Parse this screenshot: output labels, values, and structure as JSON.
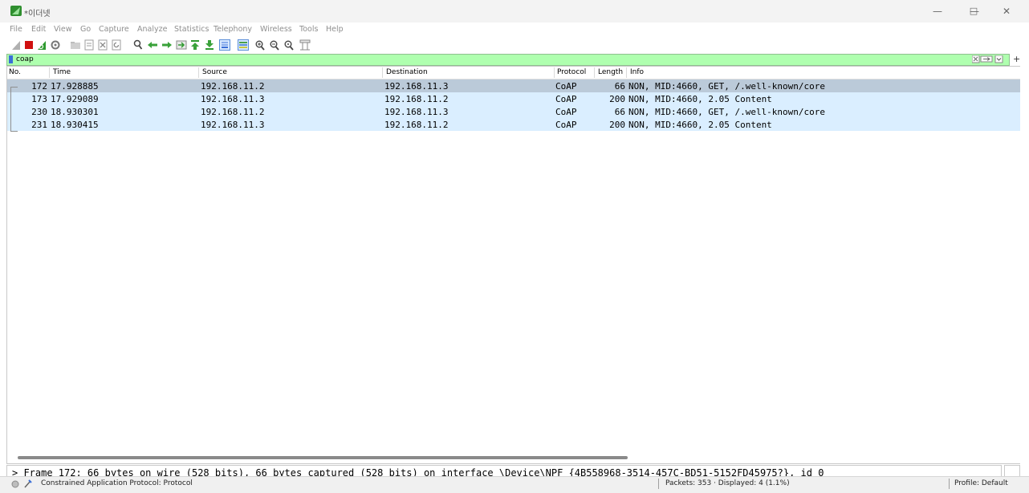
{
  "window": {
    "title": "*이더넷"
  },
  "menu": [
    "File",
    "Edit",
    "View",
    "Go",
    "Capture",
    "Analyze",
    "Statistics",
    "Telephony",
    "Wireless",
    "Tools",
    "Help"
  ],
  "filter": {
    "value": "coap",
    "add_label": "+"
  },
  "columns": [
    "No.",
    "Time",
    "Source",
    "Destination",
    "Protocol",
    "Length",
    "Info"
  ],
  "packets": [
    {
      "no": "172",
      "time": "17.928885",
      "source": "192.168.11.2",
      "destination": "192.168.11.3",
      "protocol": "CoAP",
      "length": "66",
      "info": "NON, MID:4660, GET, /.well-known/core"
    },
    {
      "no": "173",
      "time": "17.929089",
      "source": "192.168.11.3",
      "destination": "192.168.11.2",
      "protocol": "CoAP",
      "length": "200",
      "info": "NON, MID:4660, 2.05 Content"
    },
    {
      "no": "230",
      "time": "18.930301",
      "source": "192.168.11.2",
      "destination": "192.168.11.3",
      "protocol": "CoAP",
      "length": "66",
      "info": "NON, MID:4660, GET, /.well-known/core"
    },
    {
      "no": "231",
      "time": "18.930415",
      "source": "192.168.11.3",
      "destination": "192.168.11.2",
      "protocol": "CoAP",
      "length": "200",
      "info": "NON, MID:4660, 2.05 Content"
    }
  ],
  "detail": {
    "text": "> Frame 172: 66 bytes on wire (528 bits), 66 bytes captured (528 bits) on interface \\Device\\NPF_{4B558968-3514-457C-BD51-5152FD45975?}, id 0"
  },
  "status": {
    "protocol": "Constrained Application Protocol: Protocol",
    "packets": "Packets: 353 · Displayed: 4 (1.1%)",
    "profile": "Profile: Default"
  },
  "colors": {
    "selected_row": "#bbcad9",
    "udp_row": "#daeeff",
    "filter_valid": "#afffaf"
  },
  "icons": [
    "shark-fin-icon",
    "stop-capture-icon",
    "restart-capture-icon",
    "options-gear-icon",
    "open-file-icon",
    "save-file-icon",
    "close-file-icon",
    "reload-icon",
    "find-icon",
    "back-icon",
    "forward-icon",
    "go-to-packet-icon",
    "first-packet-icon",
    "last-packet-icon",
    "autoscroll-icon",
    "colorize-icon",
    "zoom-in-icon",
    "zoom-out-icon",
    "zoom-normal-icon",
    "resize-columns-icon"
  ]
}
